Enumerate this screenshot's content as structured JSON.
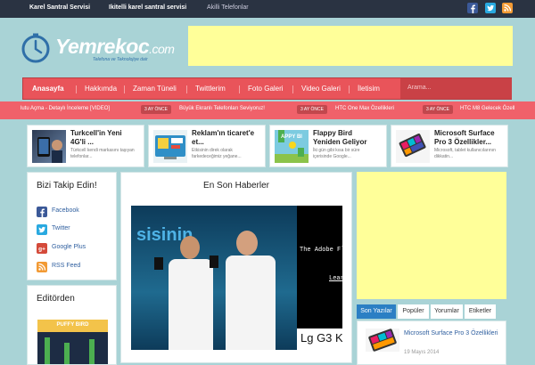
{
  "topbar": {
    "links": [
      "Karel Santral Servisi",
      "Ikitelli karel santral servisi",
      "Akilli Telefonlar"
    ],
    "social_icons": [
      "facebook-icon",
      "twitter-icon",
      "rss-icon"
    ]
  },
  "logo": {
    "name": "Yemrekoc",
    "tld": ".com",
    "tagline": "Telefona ve Teknolojiye dair"
  },
  "nav": {
    "items": [
      "Anasayfa",
      "Hakkımda",
      "Zaman Tüneli",
      "Twittlerim",
      "Foto Galeri",
      "Video Galeri",
      "İletisim"
    ],
    "search_placeholder": "Arama..."
  },
  "ticker": {
    "items": [
      "lutu Açma - Detaylı İnceleme [VIDEO]",
      "Büyük Ekranlı Telefonları Seviyoruz!",
      "HTC One Max Özellikleri",
      "HTC M8 Gelecek Özell"
    ],
    "badge": "3 AY ÖNCE"
  },
  "cards": [
    {
      "title": "Turkcell'in Yeni 4G'li ...",
      "excerpt": "Türkcell kendi markasını taşıyan telefonlar..."
    },
    {
      "title": "Reklam'ın ticaret'e et...",
      "excerpt": "Etkisinin direk olarak farkedeceğimiz yeğane..."
    },
    {
      "title": "Flappy Bird Yeniden Geliyor",
      "excerpt": "İki gün gibi kısa bir süre içerisinde Google..."
    },
    {
      "title": "Microsoft Surface Pro 3 Özellikler...",
      "excerpt": "Microsoft, tablet kullanıcılarının dikkatin..."
    }
  ],
  "follow": {
    "title": "Bizi Takip Edin!",
    "items": [
      "Facebook",
      "Twitter",
      "Google Plus",
      "RSS Feed"
    ]
  },
  "editors": {
    "title": "Editörden",
    "thumb_text": "PUFFY BIRD"
  },
  "news": {
    "title": "En Son Haberler",
    "image_text": [
      "The Adobe Fl",
      "Lear",
      "Lg G3 K"
    ],
    "banner_text": "sisinin"
  },
  "sidebar": {
    "tabs": [
      "Son Yazılar",
      "Popüler",
      "Yorumlar",
      "Etiketler"
    ],
    "post": {
      "title": "Microsoft Surface Pro 3 Özellikleri",
      "date": "19 Mayıs 2014"
    }
  },
  "colors": {
    "nav": "#e9545a",
    "ticker": "#f0616a",
    "topbar": "#2a3342",
    "ad": "#ffff99",
    "accent": "#2b7fc4"
  }
}
